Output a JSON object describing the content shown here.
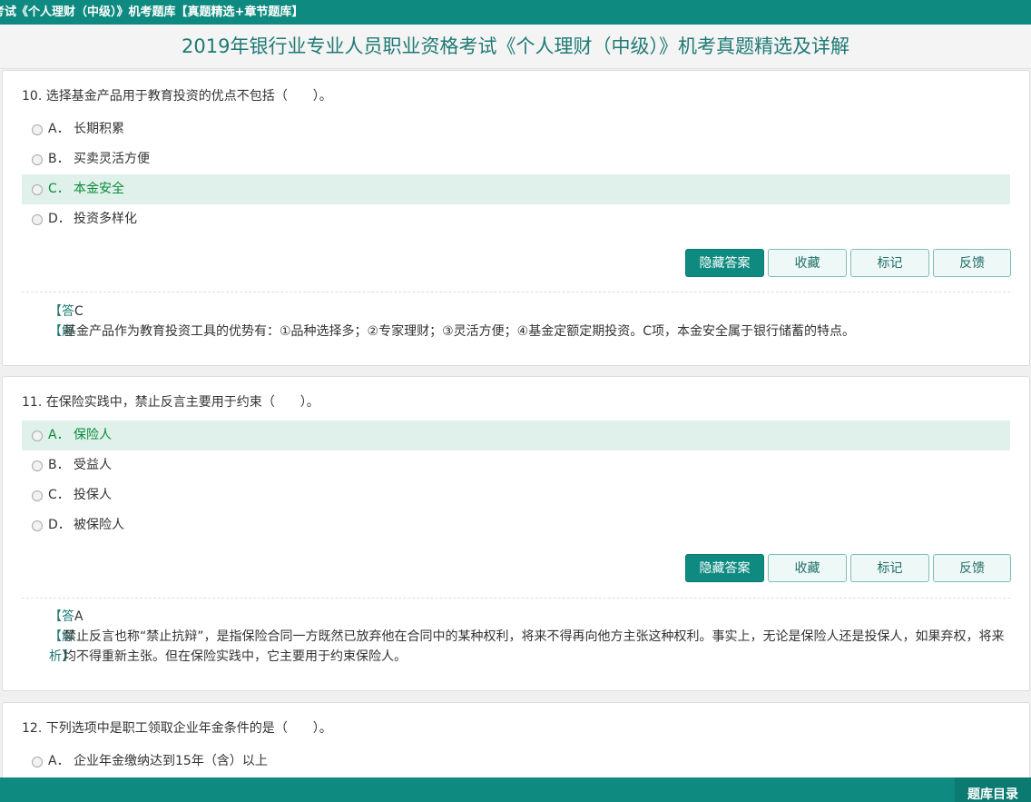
{
  "header": {
    "breadcrumb": "考试《个人理财（中级）》机考题库【真题精选+章节题库】",
    "page_title": "2019年银行业专业人员职业资格考试《个人理财（中级）》机考真题精选及详解"
  },
  "buttons": {
    "hide_answer": "隐藏答案",
    "favorite": "收藏",
    "mark": "标记",
    "feedback": "反馈"
  },
  "questions": [
    {
      "title": "10. 选择基金产品用于教育投资的优点不包括（　　）。",
      "options": [
        {
          "letter": "A．",
          "text": "长期积累"
        },
        {
          "letter": "B．",
          "text": "买卖灵活方便"
        },
        {
          "letter": "C．",
          "text": "本金安全"
        },
        {
          "letter": "D．",
          "text": "投资多样化"
        }
      ],
      "answer_label": "【答",
      "answer_value": "C",
      "explanation_label": "【解",
      "explanation": "基金产品作为教育投资工具的优势有：①品种选择多；②专家理财；③灵活方便；④基金定额定期投资。C项，本金安全属于银行储蓄的特点。"
    },
    {
      "title": "11. 在保险实践中，禁止反言主要用于约束（　　）。",
      "options": [
        {
          "letter": "A．",
          "text": "保险人"
        },
        {
          "letter": "B．",
          "text": "受益人"
        },
        {
          "letter": "C．",
          "text": "投保人"
        },
        {
          "letter": "D．",
          "text": "被保险人"
        }
      ],
      "answer_label": "【答",
      "answer_value": "A",
      "explanation_label": "【解",
      "explanation_label_2": "析】",
      "explanation": "禁止反言也称“禁止抗辩”，是指保险合同一方既然已放弃他在合同中的某种权利，将来不得再向他方主张这种权利。事实上，无论是保险人还是投保人，如果弃权，将来均不得重新主张。但在保险实践中，它主要用于约束保险人。"
    },
    {
      "title": "12. 下列选项中是职工领取企业年金条件的是（　　）。",
      "options": [
        {
          "letter": "A．",
          "text": "企业年金缴纳达到15年（含）以上"
        }
      ]
    }
  ],
  "footer": {
    "catalog_label": "题库目录"
  },
  "colors": {
    "brand": "#0e8a80",
    "highlight_bg": "#dff1ea",
    "highlight_text": "#0a8a3a"
  }
}
